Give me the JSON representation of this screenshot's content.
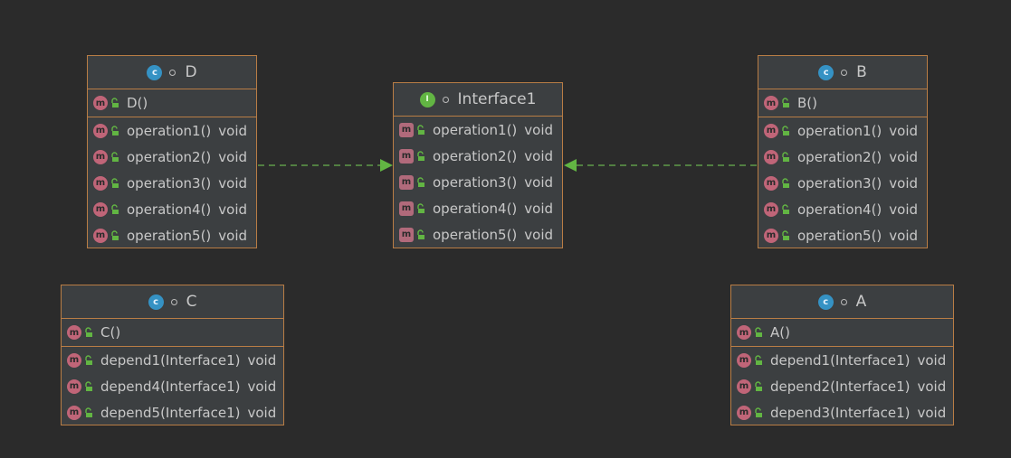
{
  "diagram": {
    "interface1": {
      "name": "Interface1",
      "members": [
        {
          "name": "operation1()",
          "type": "void"
        },
        {
          "name": "operation2()",
          "type": "void"
        },
        {
          "name": "operation3()",
          "type": "void"
        },
        {
          "name": "operation4()",
          "type": "void"
        },
        {
          "name": "operation5()",
          "type": "void"
        }
      ]
    },
    "class_d": {
      "name": "D",
      "constructor": "D()",
      "members": [
        {
          "name": "operation1()",
          "type": "void"
        },
        {
          "name": "operation2()",
          "type": "void"
        },
        {
          "name": "operation3()",
          "type": "void"
        },
        {
          "name": "operation4()",
          "type": "void"
        },
        {
          "name": "operation5()",
          "type": "void"
        }
      ]
    },
    "class_b": {
      "name": "B",
      "constructor": "B()",
      "members": [
        {
          "name": "operation1()",
          "type": "void"
        },
        {
          "name": "operation2()",
          "type": "void"
        },
        {
          "name": "operation3()",
          "type": "void"
        },
        {
          "name": "operation4()",
          "type": "void"
        },
        {
          "name": "operation5()",
          "type": "void"
        }
      ]
    },
    "class_c": {
      "name": "C",
      "constructor": "C()",
      "members": [
        {
          "name": "depend1(Interface1)",
          "type": "void"
        },
        {
          "name": "depend4(Interface1)",
          "type": "void"
        },
        {
          "name": "depend5(Interface1)",
          "type": "void"
        }
      ]
    },
    "class_a": {
      "name": "A",
      "constructor": "A()",
      "members": [
        {
          "name": "depend1(Interface1)",
          "type": "void"
        },
        {
          "name": "depend2(Interface1)",
          "type": "void"
        },
        {
          "name": "depend3(Interface1)",
          "type": "void"
        }
      ]
    },
    "edges": [
      {
        "from": "D",
        "to": "Interface1",
        "kind": "implements"
      },
      {
        "from": "B",
        "to": "Interface1",
        "kind": "implements"
      }
    ]
  },
  "colors": {
    "background": "#2b2b2b",
    "box_fill": "#3c3f41",
    "box_border": "#b97d45",
    "text": "#c8c8c8",
    "class_icon": "#3592c4",
    "interface_icon": "#62b543",
    "method_icon": "#c06578",
    "edge": "#62b543"
  }
}
